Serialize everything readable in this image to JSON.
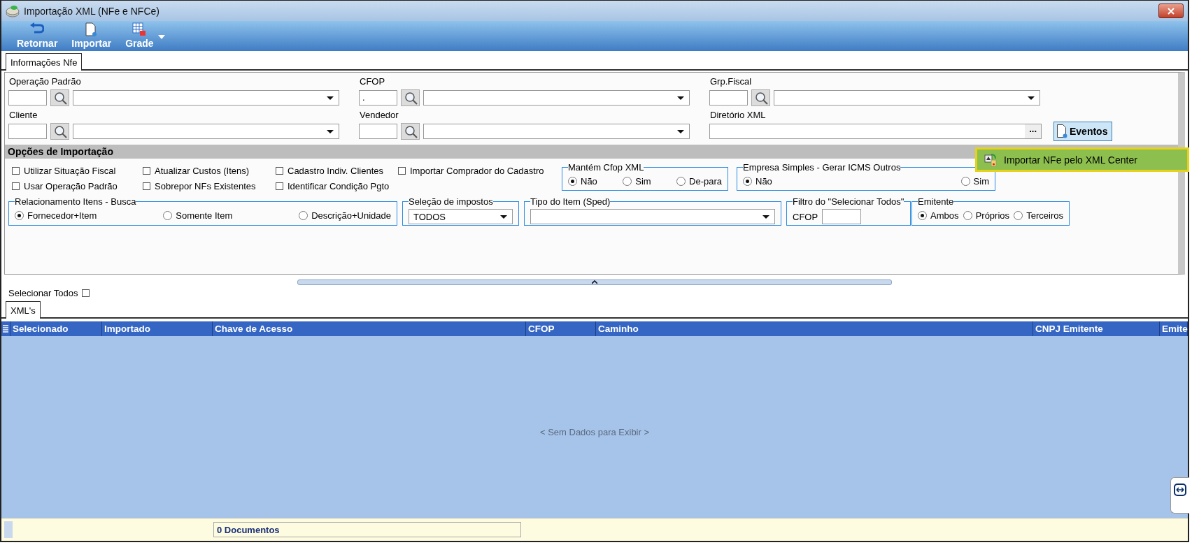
{
  "window": {
    "title": "Importação XML (NFe e NFCe)"
  },
  "toolbar": [
    {
      "label": "Retornar",
      "kind": "return"
    },
    {
      "label": "Importar",
      "kind": "document"
    },
    {
      "label": "Grade",
      "kind": "grid",
      "dropdown": true
    }
  ],
  "tabs": [
    {
      "label": "Informações Nfe",
      "selected": true
    }
  ],
  "field_columns": [
    [
      {
        "label": "Operação Padrão",
        "kind": "lookup"
      },
      {
        "label": "Cliente",
        "kind": "lookup"
      }
    ],
    [
      {
        "label": "CFOP",
        "kind": "lookup",
        "value": "."
      },
      {
        "label": "Vendedor",
        "kind": "lookup"
      }
    ],
    [
      {
        "label": "Grp.Fiscal",
        "kind": "lookup"
      },
      {
        "label": "Diretório XML",
        "kind": "path",
        "browse": "...",
        "button": "Eventos"
      }
    ]
  ],
  "events_menu": {
    "items": [
      {
        "label": "Importar NFe pelo XML Center",
        "selected": true
      }
    ]
  },
  "options": {
    "title": "Opções de Importação",
    "checkboxes": [
      {
        "label": "Utilizar Situação Fiscal",
        "checked": false
      },
      {
        "label": "Atualizar Custos (Itens)",
        "checked": false
      },
      {
        "label": "Cadastro Indiv. Clientes",
        "checked": false
      },
      {
        "label": "Importar Comprador do Cadastro",
        "checked": false
      },
      {
        "label": "Usar Operação Padrão",
        "checked": false
      },
      {
        "label": "Sobrepor NFs Existentes",
        "checked": false
      },
      {
        "label": "Identificar Condição Pgto",
        "checked": false
      }
    ],
    "groups_top": [
      {
        "title": "Mantém Cfop XML",
        "kind": "radio",
        "options": [
          {
            "label": "Não",
            "selected": true
          },
          {
            "label": "Sim",
            "selected": false
          },
          {
            "label": "De-para",
            "selected": false
          }
        ]
      },
      {
        "title": "Empresa Simples - Gerar ICMS Outros",
        "kind": "radio",
        "options": [
          {
            "label": "Não",
            "selected": true
          },
          {
            "label": "Sim",
            "selected": false
          }
        ]
      }
    ],
    "groups_bottom": [
      {
        "title": "Relacionamento Itens - Busca",
        "kind": "radio",
        "options": [
          {
            "label": "Fornecedor+Item",
            "selected": true
          },
          {
            "label": "Somente Item",
            "selected": false
          },
          {
            "label": "Descrição+Unidade",
            "selected": false
          }
        ]
      },
      {
        "title": "Seleção de impostos",
        "kind": "select",
        "value": "TODOS"
      },
      {
        "title": "Tipo do Item (Sped)",
        "kind": "select"
      },
      {
        "title": "Filtro do \"Selecionar Todos\"",
        "kind": "input",
        "label": "CFOP"
      },
      {
        "title": "Emitente",
        "kind": "radio",
        "options": [
          {
            "label": "Ambos",
            "selected": true
          },
          {
            "label": "Próprios",
            "selected": false
          },
          {
            "label": "Terceiros",
            "selected": false
          }
        ]
      }
    ]
  },
  "select_all": {
    "label": "Selecionar Todos",
    "checked": false
  },
  "grid": {
    "tabs": [
      {
        "label": "XML's",
        "selected": true
      }
    ],
    "columns": [
      "Selecionado",
      "Importado",
      "Chave de Acesso",
      "CFOP",
      "Caminho",
      "CNPJ Emitente",
      "Emite"
    ],
    "empty_text": "< Sem Dados para Exibir >"
  },
  "status_bar": {
    "count": "0 Documentos"
  }
}
